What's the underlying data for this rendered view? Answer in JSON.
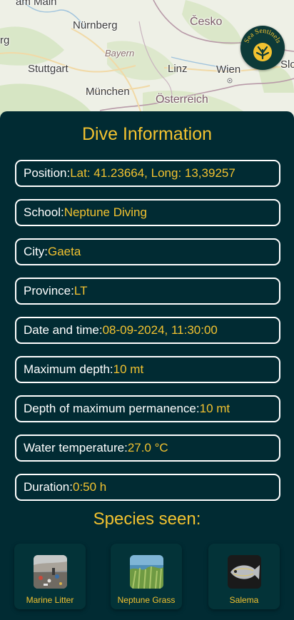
{
  "map": {
    "labels": {
      "top_left_partial": "am Main",
      "left_partial": "rg",
      "nuernberg": "Nürnberg",
      "cesko": "Česko",
      "bayern": "Bayern",
      "stuttgart": "Stuttgart",
      "linz": "Linz",
      "wien": "Wien",
      "right_partial": "Slo",
      "muenchen": "München",
      "oesterreich": "Österreich"
    }
  },
  "logo": {
    "text": "Sea Sentinels"
  },
  "dive": {
    "title": "Dive Information",
    "fields": [
      {
        "label": "Position: ",
        "value": "Lat: 41.23664, Long: 13,39257"
      },
      {
        "label": "School: ",
        "value": "Neptune Diving"
      },
      {
        "label": "City: ",
        "value": "Gaeta"
      },
      {
        "label": "Province: ",
        "value": "LT"
      },
      {
        "label": "Date and time: ",
        "value": "08-09-2024, 11:30:00"
      },
      {
        "label": "Maximum depth: ",
        "value": "10 mt"
      },
      {
        "label": "Depth of maximum permanence: ",
        "value": "10 mt"
      },
      {
        "label": "Water temperature: ",
        "value": "27.0 °C"
      },
      {
        "label": "Duration: ",
        "value": "0:50 h"
      }
    ]
  },
  "species": {
    "title": "Species seen:",
    "items": [
      {
        "name": "Marine Litter"
      },
      {
        "name": "Neptune Grass"
      },
      {
        "name": "Salema"
      }
    ]
  },
  "colors": {
    "background": "#012b33",
    "accent": "#f2c230",
    "border": "#ffffff"
  }
}
